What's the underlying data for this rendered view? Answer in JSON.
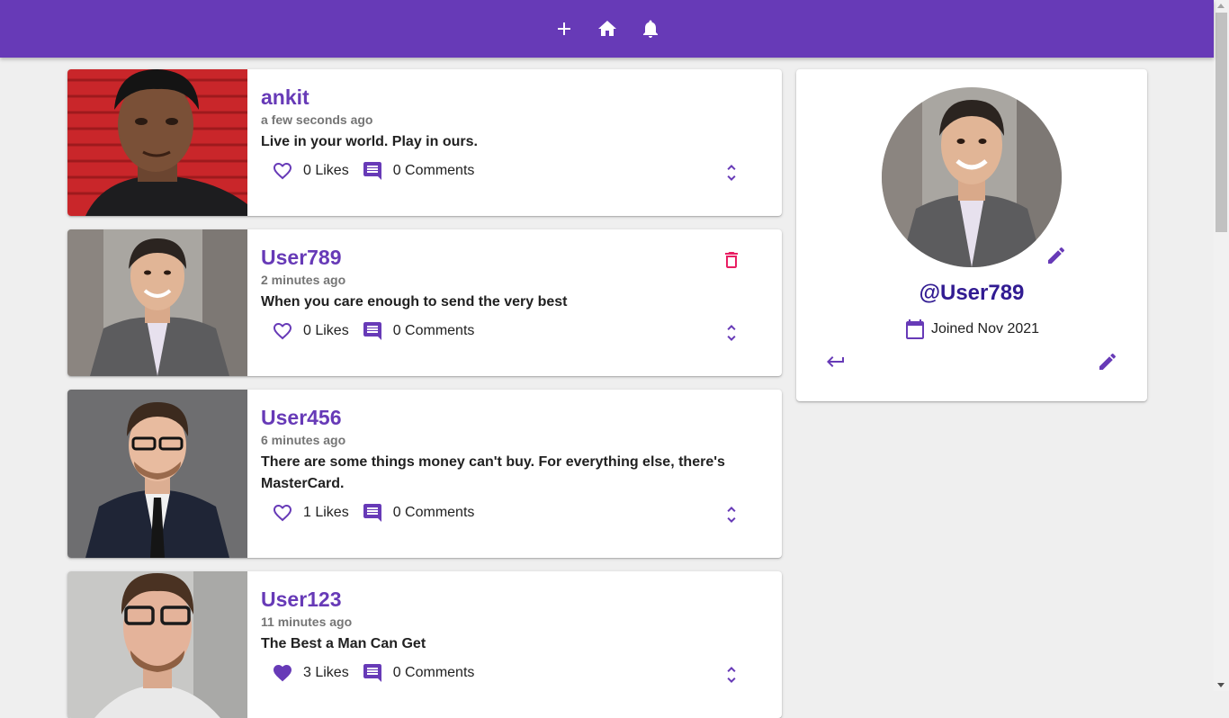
{
  "topbar": {
    "icons": [
      "add-icon",
      "home-icon",
      "bell-icon"
    ],
    "color": "#673ab7"
  },
  "posts": [
    {
      "handle": "ankit",
      "time": "a few seconds ago",
      "body": "Live in your world. Play in ours.",
      "likes": "0 Likes",
      "comments": "0 Comments",
      "liked": false,
      "deletable": false
    },
    {
      "handle": "User789",
      "time": "2 minutes ago",
      "body": "When you care enough to send the very best",
      "likes": "0 Likes",
      "comments": "0 Comments",
      "liked": false,
      "deletable": true
    },
    {
      "handle": "User456",
      "time": "6 minutes ago",
      "body": "There are some things money can't buy. For everything else, there's MasterCard.",
      "likes": "1 Likes",
      "comments": "0 Comments",
      "liked": false,
      "deletable": false
    },
    {
      "handle": "User123",
      "time": "11 minutes ago",
      "body": "The Best a Man Can Get",
      "likes": "3 Likes",
      "comments": "0 Comments",
      "liked": true,
      "deletable": false
    }
  ],
  "profile": {
    "username": "@User789",
    "joined": "Joined Nov 2021"
  },
  "colors": {
    "accent": "#673ab7",
    "username": "#311b92",
    "delete": "#e91e63",
    "background": "#efefef"
  }
}
